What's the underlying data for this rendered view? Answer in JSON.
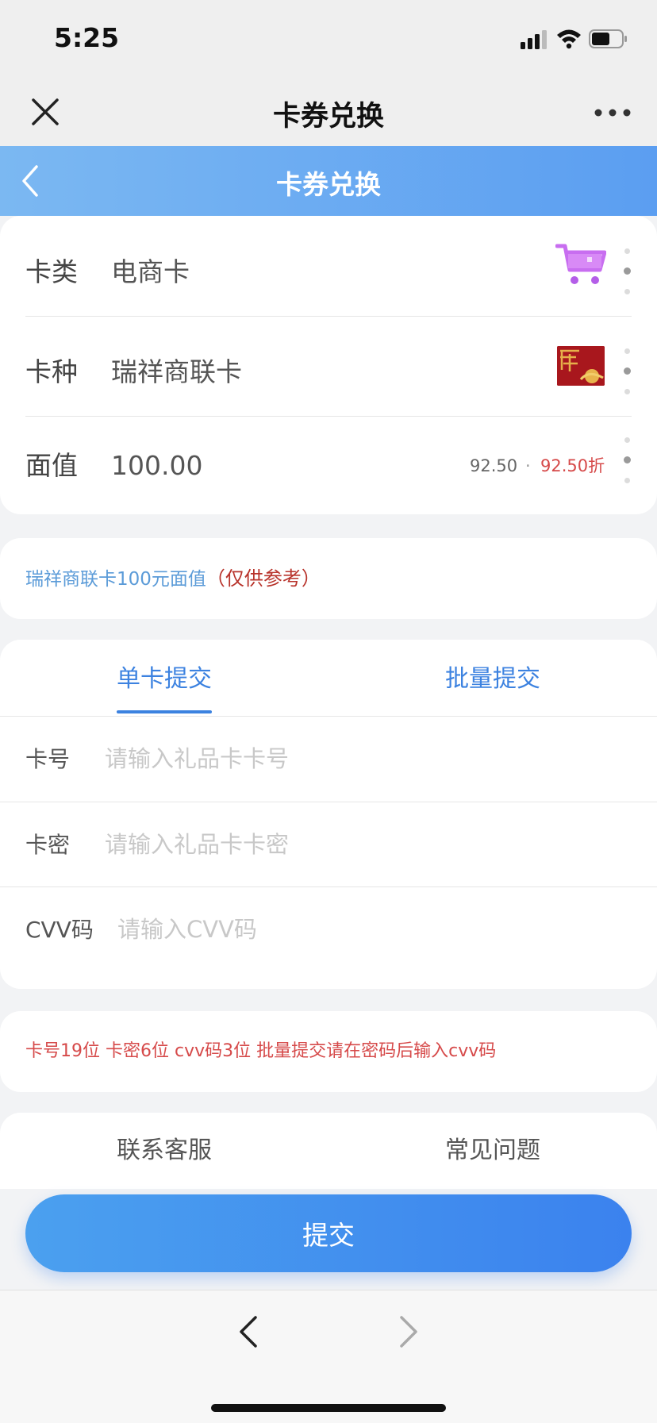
{
  "status_bar": {
    "time": "5:25"
  },
  "nav": {
    "title": "卡券兑换",
    "close_icon": "close-icon",
    "more_icon": "more-icon"
  },
  "header": {
    "title": "卡券兑换",
    "back_icon": "chevron-left-icon",
    "gradient": [
      "#7bb8f2",
      "#5b9ef1"
    ]
  },
  "card_info": {
    "type_label": "卡类",
    "type_value": "电商卡",
    "type_icon": "shopping-cart-icon",
    "kind_label": "卡种",
    "kind_value": "瑞祥商联卡",
    "face_label": "面值",
    "face_value": "100.00",
    "rate_value": "92.50",
    "rate_separator": "·",
    "rate_discount": "92.50折"
  },
  "notice": {
    "text": "瑞祥商联卡100元面值",
    "suffix": "（仅供参考）"
  },
  "tabs": [
    {
      "label": "单卡提交",
      "active": true
    },
    {
      "label": "批量提交",
      "active": false
    }
  ],
  "form": {
    "card_number": {
      "label": "卡号",
      "placeholder": "请输入礼品卡卡号",
      "value": ""
    },
    "card_password": {
      "label": "卡密",
      "placeholder": "请输入礼品卡卡密",
      "value": ""
    },
    "cvv": {
      "label": "CVV码",
      "placeholder": "请输入CVV码",
      "value": ""
    }
  },
  "hint": "卡号19位 卡密6位 cvv码3位 批量提交请在密码后输入cvv码",
  "links": {
    "service": "联系客服",
    "faq": "常见问题"
  },
  "submit_label": "提交",
  "colors": {
    "accent": "#3c82e0",
    "warning": "#d64a4a",
    "notice_blue": "#5b9bd8",
    "notice_red": "#b8332b"
  }
}
